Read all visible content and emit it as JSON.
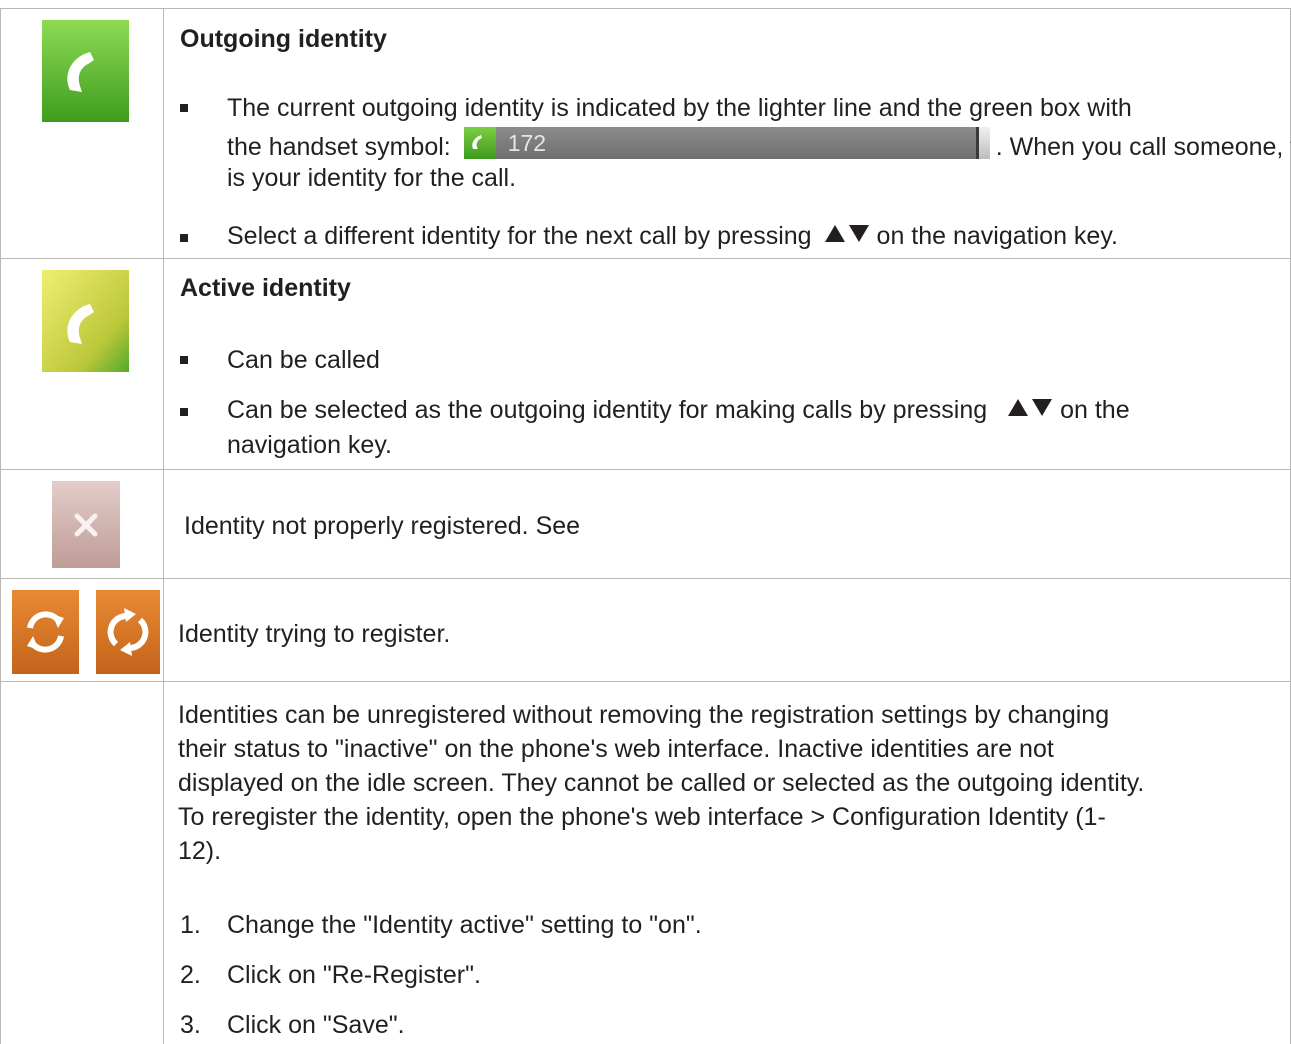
{
  "rows": {
    "outgoing": {
      "heading": "Outgoing identity",
      "bullet1_line1": "The current outgoing identity is indicated by the lighter line and the green box with",
      "bullet1_line2_before": "the handset symbol:",
      "bullet1_line2_after": ". When you call someone, this",
      "bullet1_line3": "is your identity for the call.",
      "inline_identity_number": "172",
      "bullet2_before": "Select a different identity for the next call by pressing",
      "bullet2_after": "on the navigation key.",
      "icon": "handset-icon",
      "icon_color": "#4fad2a"
    },
    "active": {
      "heading": "Active identity",
      "bullet1": "Can be called",
      "bullet2_line1_before": "Can be selected as the outgoing identity for making calls by pressing",
      "bullet2_line1_after": "on the",
      "bullet2_line2": "navigation key.",
      "icon": "handset-icon",
      "icon_color": "#c6cf3c"
    },
    "not_registered": {
      "text": "Identity not properly registered.  See",
      "icon": "x-icon",
      "icon_color": "#c9a8a2"
    },
    "trying": {
      "text": "Identity trying to register.",
      "icons": [
        "refresh-icon",
        "refresh-icon"
      ],
      "icon_color": "#d36f1c"
    },
    "inactive": {
      "para_lines": [
        "Identities can be unregistered without removing the registration settings by changing",
        "their status to \"inactive\" on the phone's web interface.  Inactive identities are not",
        "displayed on the idle screen.  They cannot be called or selected as the outgoing identity.",
        "To reregister the identity, open the phone's web interface  >  Configuration Identity (1-",
        "12)."
      ],
      "steps": [
        {
          "num": "1.",
          "text": "Change the \"Identity active\" setting to \"on\"."
        },
        {
          "num": "2.",
          "text": "Click on \"Re-Register\"."
        },
        {
          "num": "3.",
          "text": "Click on \"Save\"."
        }
      ]
    }
  }
}
